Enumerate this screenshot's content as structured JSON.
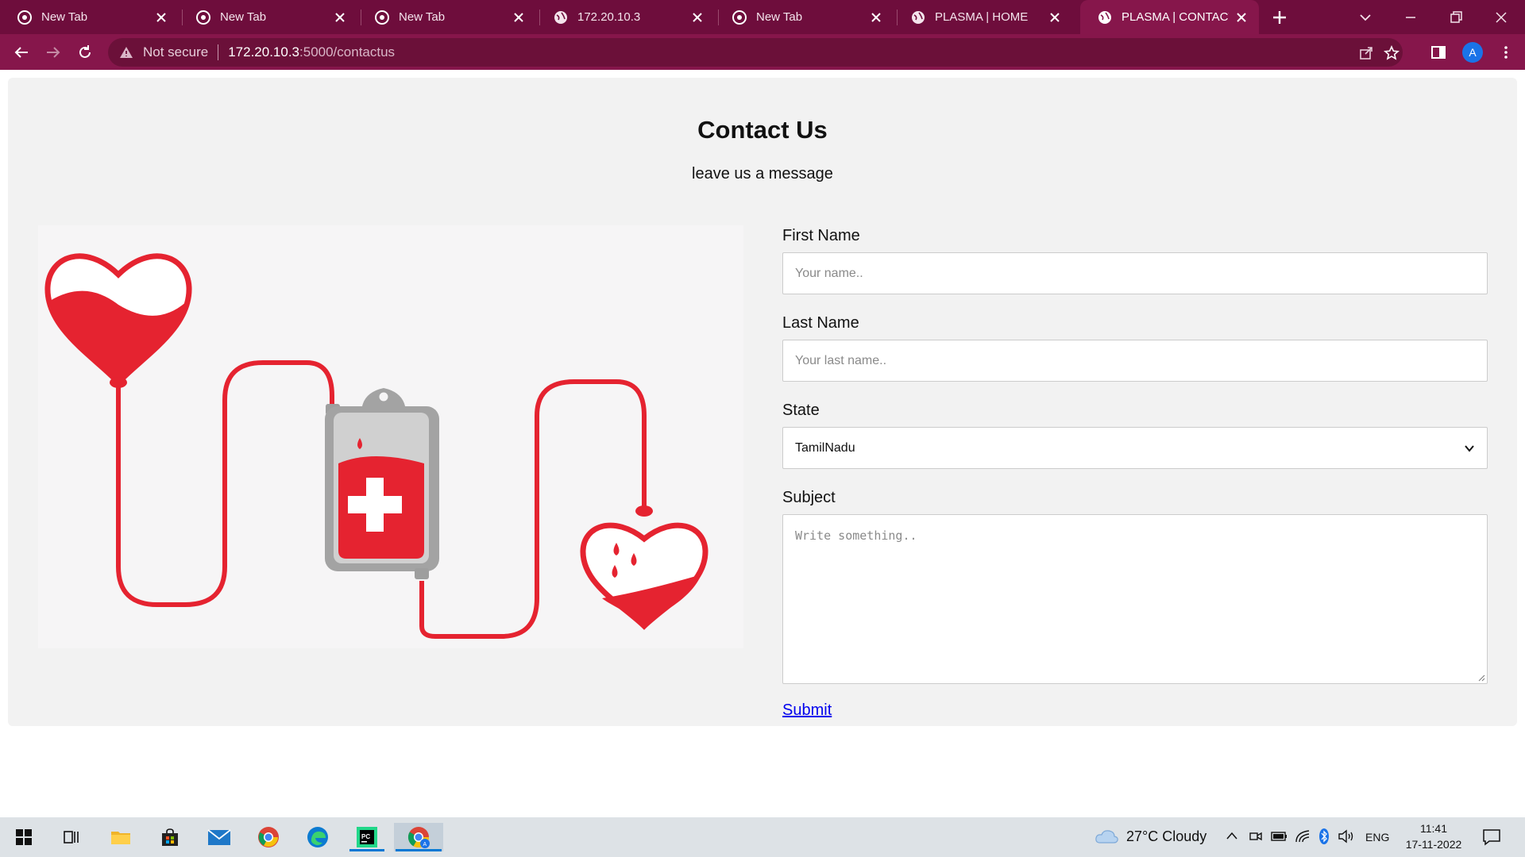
{
  "browser": {
    "tabs": [
      {
        "title": "New Tab",
        "favicon": "chrome-icon",
        "active": false
      },
      {
        "title": "New Tab",
        "favicon": "chrome-icon",
        "active": false
      },
      {
        "title": "New Tab",
        "favicon": "chrome-icon",
        "active": false
      },
      {
        "title": "172.20.10.3",
        "favicon": "globe-icon",
        "active": false
      },
      {
        "title": "New Tab",
        "favicon": "chrome-icon",
        "active": false
      },
      {
        "title": "PLASMA | HOME",
        "favicon": "globe-icon",
        "active": false
      },
      {
        "title": "PLASMA | CONTACT US",
        "favicon": "globe-icon",
        "active": true
      }
    ],
    "security_label": "Not secure",
    "url_host": "172.20.10.3",
    "url_path": ":5000/contactus",
    "profile_initial": "A",
    "theme_color": "#86164b"
  },
  "page": {
    "title": "Contact Us",
    "subtitle": "leave us a message",
    "form": {
      "first_name_label": "First Name",
      "first_name_placeholder": "Your name..",
      "last_name_label": "Last Name",
      "last_name_placeholder": "Your last name..",
      "state_label": "State",
      "state_value": "TamilNadu",
      "subject_label": "Subject",
      "subject_placeholder": "Write something..",
      "submit_label": "Submit"
    },
    "accent_color": "#e52330"
  },
  "taskbar": {
    "weather": "27°C  Cloudy",
    "language": "ENG",
    "time": "11:41",
    "date": "17-11-2022"
  }
}
